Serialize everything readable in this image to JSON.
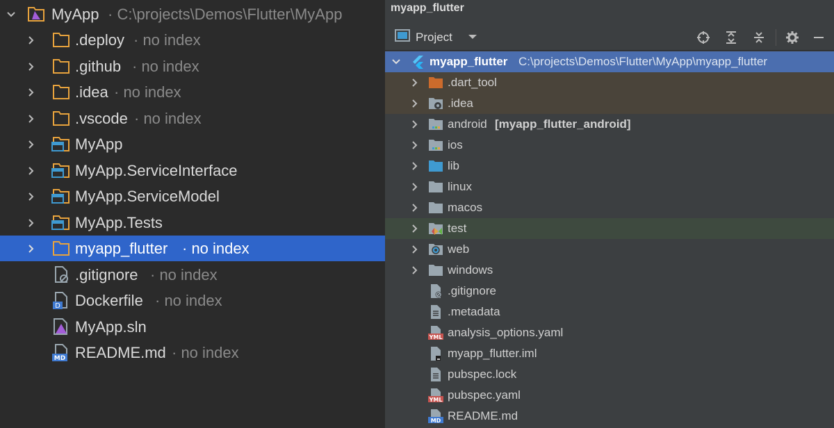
{
  "left": {
    "root": {
      "label": "MyApp",
      "note": "· C:\\projects\\Demos\\Flutter\\MyApp"
    },
    "items": [
      {
        "label": ".deploy",
        "note": "· no index"
      },
      {
        "label": ".github",
        "note": "· no index"
      },
      {
        "label": ".idea",
        "note": "· no index"
      },
      {
        "label": ".vscode",
        "note": "· no index"
      },
      {
        "label": "MyApp",
        "note": ""
      },
      {
        "label": "MyApp.ServiceInterface",
        "note": ""
      },
      {
        "label": "MyApp.ServiceModel",
        "note": ""
      },
      {
        "label": "MyApp.Tests",
        "note": ""
      },
      {
        "label": "myapp_flutter",
        "note": "· no index"
      },
      {
        "label": ".gitignore",
        "note": "· no index"
      },
      {
        "label": "Dockerfile",
        "note": "· no index"
      },
      {
        "label": "MyApp.sln",
        "note": ""
      },
      {
        "label": "README.md",
        "note": "· no index"
      }
    ]
  },
  "right": {
    "title": "myapp_flutter",
    "toolbar": {
      "view_label": "Project"
    },
    "root": {
      "label": "myapp_flutter",
      "path": "C:\\projects\\Demos\\Flutter\\MyApp\\myapp_flutter"
    },
    "items": [
      {
        "label": ".dart_tool",
        "extra": ""
      },
      {
        "label": ".idea",
        "extra": ""
      },
      {
        "label": "android",
        "extra": "[myapp_flutter_android]"
      },
      {
        "label": "ios",
        "extra": ""
      },
      {
        "label": "lib",
        "extra": ""
      },
      {
        "label": "linux",
        "extra": ""
      },
      {
        "label": "macos",
        "extra": ""
      },
      {
        "label": "test",
        "extra": ""
      },
      {
        "label": "web",
        "extra": ""
      },
      {
        "label": "windows",
        "extra": ""
      },
      {
        "label": ".gitignore",
        "extra": ""
      },
      {
        "label": ".metadata",
        "extra": ""
      },
      {
        "label": "analysis_options.yaml",
        "extra": ""
      },
      {
        "label": "myapp_flutter.iml",
        "extra": ""
      },
      {
        "label": "pubspec.lock",
        "extra": ""
      },
      {
        "label": "pubspec.yaml",
        "extra": ""
      },
      {
        "label": "README.md",
        "extra": ""
      }
    ]
  },
  "colors": {
    "selection": "#2f65ca",
    "excluded_row": "#4a443a",
    "test_row": "#3e4a3f",
    "root_row": "#4b6eaf",
    "folder_orange": "#e8a33d",
    "folder_gray": "#9aa7b0",
    "folder_blue": "#3f9ad1"
  }
}
